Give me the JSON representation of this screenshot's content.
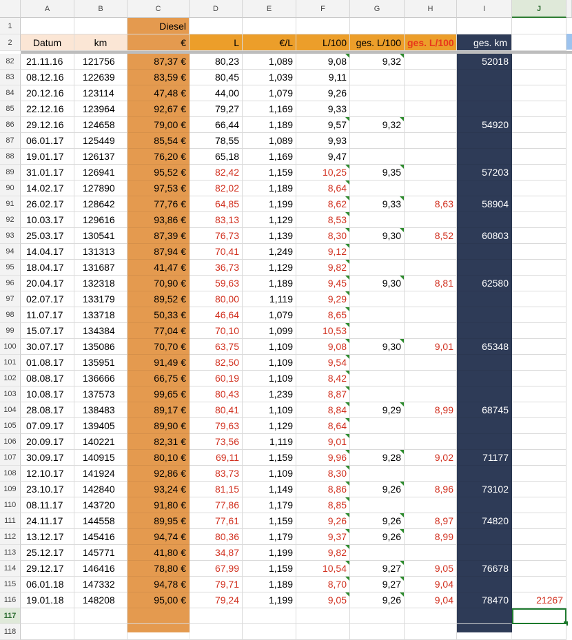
{
  "columns": [
    "A",
    "B",
    "C",
    "D",
    "E",
    "F",
    "G",
    "H",
    "I",
    "J"
  ],
  "selected_column": "J",
  "selected_row": "117",
  "header_row1": {
    "row": "1",
    "c_label": "Diesel"
  },
  "header_row2": {
    "row": "2",
    "a": "Datum",
    "b": "km",
    "c": "€",
    "d": "L",
    "e": "€/L",
    "f": "L/100",
    "g": "ges. L/100",
    "h": "ges. L/100",
    "i": "ges. km"
  },
  "rows": [
    {
      "n": "82",
      "date": "21.11.16",
      "km": "121756",
      "eur": "87,37 €",
      "l": "80,23",
      "epl": "1,089",
      "l100": "9,08",
      "g": "9,32",
      "h": "",
      "i": "52018"
    },
    {
      "n": "83",
      "date": "08.12.16",
      "km": "122639",
      "eur": "83,59 €",
      "l": "80,45",
      "epl": "1,039",
      "l100": "9,11",
      "g": "",
      "h": "",
      "i": ""
    },
    {
      "n": "84",
      "date": "20.12.16",
      "km": "123114",
      "eur": "47,48 €",
      "l": "44,00",
      "epl": "1,079",
      "l100": "9,26",
      "g": "",
      "h": "",
      "i": ""
    },
    {
      "n": "85",
      "date": "22.12.16",
      "km": "123964",
      "eur": "92,67 €",
      "l": "79,27",
      "epl": "1,169",
      "l100": "9,33",
      "g": "",
      "h": "",
      "i": ""
    },
    {
      "n": "86",
      "date": "29.12.16",
      "km": "124658",
      "eur": "79,00 €",
      "l": "66,44",
      "epl": "1,189",
      "l100": "9,57",
      "g": "9,32",
      "h": "",
      "i": "54920"
    },
    {
      "n": "87",
      "date": "06.01.17",
      "km": "125449",
      "eur": "85,54 €",
      "l": "78,55",
      "epl": "1,089",
      "l100": "9,93",
      "g": "",
      "h": "",
      "i": ""
    },
    {
      "n": "88",
      "date": "19.01.17",
      "km": "126137",
      "eur": "76,20 €",
      "l": "65,18",
      "epl": "1,169",
      "l100": "9,47",
      "g": "",
      "h": "",
      "i": ""
    },
    {
      "n": "89",
      "date": "31.01.17",
      "km": "126941",
      "eur": "95,52 €",
      "l": "82,42",
      "epl": "1,159",
      "l100": "10,25",
      "g": "9,35",
      "h": "",
      "i": "57203"
    },
    {
      "n": "90",
      "date": "14.02.17",
      "km": "127890",
      "eur": "97,53 €",
      "l": "82,02",
      "epl": "1,189",
      "l100": "8,64",
      "g": "",
      "h": "",
      "i": ""
    },
    {
      "n": "91",
      "date": "26.02.17",
      "km": "128642",
      "eur": "77,76 €",
      "l": "64,85",
      "epl": "1,199",
      "l100": "8,62",
      "g": "9,33",
      "h": "8,63",
      "i": "58904"
    },
    {
      "n": "92",
      "date": "10.03.17",
      "km": "129616",
      "eur": "93,86 €",
      "l": "83,13",
      "epl": "1,129",
      "l100": "8,53",
      "g": "",
      "h": "",
      "i": ""
    },
    {
      "n": "93",
      "date": "25.03.17",
      "km": "130541",
      "eur": "87,39 €",
      "l": "76,73",
      "epl": "1,139",
      "l100": "8,30",
      "g": "9,30",
      "h": "8,52",
      "i": "60803"
    },
    {
      "n": "94",
      "date": "14.04.17",
      "km": "131313",
      "eur": "87,94 €",
      "l": "70,41",
      "epl": "1,249",
      "l100": "9,12",
      "g": "",
      "h": "",
      "i": ""
    },
    {
      "n": "95",
      "date": "18.04.17",
      "km": "131687",
      "eur": "41,47 €",
      "l": "36,73",
      "epl": "1,129",
      "l100": "9,82",
      "g": "",
      "h": "",
      "i": ""
    },
    {
      "n": "96",
      "date": "20.04.17",
      "km": "132318",
      "eur": "70,90 €",
      "l": "59,63",
      "epl": "1,189",
      "l100": "9,45",
      "g": "9,30",
      "h": "8,81",
      "i": "62580"
    },
    {
      "n": "97",
      "date": "02.07.17",
      "km": "133179",
      "eur": "89,52 €",
      "l": "80,00",
      "epl": "1,119",
      "l100": "9,29",
      "g": "",
      "h": "",
      "i": ""
    },
    {
      "n": "98",
      "date": "11.07.17",
      "km": "133718",
      "eur": "50,33 €",
      "l": "46,64",
      "epl": "1,079",
      "l100": "8,65",
      "g": "",
      "h": "",
      "i": ""
    },
    {
      "n": "99",
      "date": "15.07.17",
      "km": "134384",
      "eur": "77,04 €",
      "l": "70,10",
      "epl": "1,099",
      "l100": "10,53",
      "g": "",
      "h": "",
      "i": ""
    },
    {
      "n": "100",
      "date": "30.07.17",
      "km": "135086",
      "eur": "70,70 €",
      "l": "63,75",
      "epl": "1,109",
      "l100": "9,08",
      "g": "9,30",
      "h": "9,01",
      "i": "65348"
    },
    {
      "n": "101",
      "date": "01.08.17",
      "km": "135951",
      "eur": "91,49 €",
      "l": "82,50",
      "epl": "1,109",
      "l100": "9,54",
      "g": "",
      "h": "",
      "i": ""
    },
    {
      "n": "102",
      "date": "08.08.17",
      "km": "136666",
      "eur": "66,75 €",
      "l": "60,19",
      "epl": "1,109",
      "l100": "8,42",
      "g": "",
      "h": "",
      "i": ""
    },
    {
      "n": "103",
      "date": "10.08.17",
      "km": "137573",
      "eur": "99,65 €",
      "l": "80,43",
      "epl": "1,239",
      "l100": "8,87",
      "g": "",
      "h": "",
      "i": ""
    },
    {
      "n": "104",
      "date": "28.08.17",
      "km": "138483",
      "eur": "89,17 €",
      "l": "80,41",
      "epl": "1,109",
      "l100": "8,84",
      "g": "9,29",
      "h": "8,99",
      "i": "68745"
    },
    {
      "n": "105",
      "date": "07.09.17",
      "km": "139405",
      "eur": "89,90 €",
      "l": "79,63",
      "epl": "1,129",
      "l100": "8,64",
      "g": "",
      "h": "",
      "i": ""
    },
    {
      "n": "106",
      "date": "20.09.17",
      "km": "140221",
      "eur": "82,31 €",
      "l": "73,56",
      "epl": "1,119",
      "l100": "9,01",
      "g": "",
      "h": "",
      "i": ""
    },
    {
      "n": "107",
      "date": "30.09.17",
      "km": "140915",
      "eur": "80,10 €",
      "l": "69,11",
      "epl": "1,159",
      "l100": "9,96",
      "g": "9,28",
      "h": "9,02",
      "i": "71177"
    },
    {
      "n": "108",
      "date": "12.10.17",
      "km": "141924",
      "eur": "92,86 €",
      "l": "83,73",
      "epl": "1,109",
      "l100": "8,30",
      "g": "",
      "h": "",
      "i": ""
    },
    {
      "n": "109",
      "date": "23.10.17",
      "km": "142840",
      "eur": "93,24 €",
      "l": "81,15",
      "epl": "1,149",
      "l100": "8,86",
      "g": "9,26",
      "h": "8,96",
      "i": "73102"
    },
    {
      "n": "110",
      "date": "08.11.17",
      "km": "143720",
      "eur": "91,80 €",
      "l": "77,86",
      "epl": "1,179",
      "l100": "8,85",
      "g": "",
      "h": "",
      "i": ""
    },
    {
      "n": "111",
      "date": "24.11.17",
      "km": "144558",
      "eur": "89,95 €",
      "l": "77,61",
      "epl": "1,159",
      "l100": "9,26",
      "g": "9,26",
      "h": "8,97",
      "i": "74820"
    },
    {
      "n": "112",
      "date": "13.12.17",
      "km": "145416",
      "eur": "94,74 €",
      "l": "80,36",
      "epl": "1,179",
      "l100": "9,37",
      "g": "9,26",
      "h": "8,99",
      "i": ""
    },
    {
      "n": "113",
      "date": "25.12.17",
      "km": "145771",
      "eur": "41,80 €",
      "l": "34,87",
      "epl": "1,199",
      "l100": "9,82",
      "g": "",
      "h": "",
      "i": ""
    },
    {
      "n": "114",
      "date": "29.12.17",
      "km": "146416",
      "eur": "78,80 €",
      "l": "67,99",
      "epl": "1,159",
      "l100": "10,54",
      "g": "9,27",
      "h": "9,05",
      "i": "76678"
    },
    {
      "n": "115",
      "date": "06.01.18",
      "km": "147332",
      "eur": "94,78 €",
      "l": "79,71",
      "epl": "1,189",
      "l100": "8,70",
      "g": "9,27",
      "h": "9,04",
      "i": ""
    },
    {
      "n": "116",
      "date": "19.01.18",
      "km": "148208",
      "eur": "95,00 €",
      "l": "79,24",
      "epl": "1,199",
      "l100": "9,05",
      "g": "9,26",
      "h": "9,04",
      "i": "78470",
      "j": "21267"
    }
  ],
  "trailing_rows": [
    "117",
    "118"
  ],
  "colors": {
    "diesel_orange": "#e49a4f",
    "header_orange": "#ec9e2a",
    "navy": "#2e3b57",
    "red_text": "#d1301f",
    "selection_green": "#1e7a2e"
  }
}
